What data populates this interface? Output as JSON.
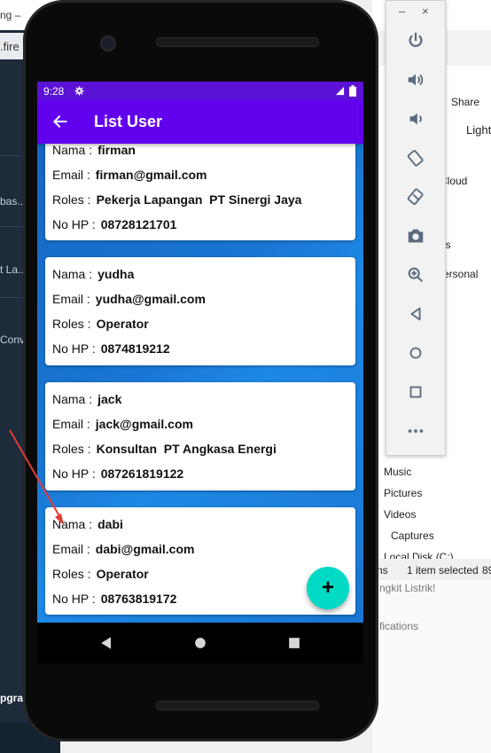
{
  "background": {
    "left_texts": [
      "ng –",
      ".fire",
      "bas..",
      "t La..",
      "Conv",
      "pgra"
    ],
    "right_texts": [
      "Share",
      "Light",
      "Cloud",
      "es",
      "ersonal",
      "Music",
      "Pictures",
      "Videos",
      "Captures",
      "Local Disk (C:)",
      "ns",
      "1 item selected",
      "89",
      "ngkit Listrik!",
      "fications"
    ]
  },
  "toolbar": {
    "minimize": "–",
    "close": "×",
    "icons": [
      "power-icon",
      "volume-up-icon",
      "volume-down-icon",
      "rotate-left-icon",
      "rotate-right-icon",
      "camera-icon",
      "zoom-icon",
      "back-icon",
      "home-icon",
      "overview-icon",
      "more-icon"
    ]
  },
  "status_bar": {
    "time": "9:28"
  },
  "app_bar": {
    "title": "List User"
  },
  "users": [
    {
      "nama_label": "Nama :",
      "nama": "firman",
      "email_label": "Email :",
      "email": "firman@gmail.com",
      "roles_label": "Roles :",
      "roles": "Pekerja Lapangan  PT Sinergi Jaya",
      "hp_label": "No HP :",
      "hp": "08728121701"
    },
    {
      "nama_label": "Nama :",
      "nama": "yudha",
      "email_label": "Email :",
      "email": "yudha@gmail.com",
      "roles_label": "Roles :",
      "roles": "Operator",
      "hp_label": "No HP :",
      "hp": "0874819212"
    },
    {
      "nama_label": "Nama :",
      "nama": "jack",
      "email_label": "Email :",
      "email": "jack@gmail.com",
      "roles_label": "Roles :",
      "roles": "Konsultan  PT Angkasa Energi",
      "hp_label": "No HP :",
      "hp": "087261819122"
    },
    {
      "nama_label": "Nama :",
      "nama": "dabi",
      "email_label": "Email :",
      "email": "dabi@gmail.com",
      "roles_label": "Roles :",
      "roles": "Operator",
      "hp_label": "No HP :",
      "hp": "08763819172"
    }
  ],
  "fab": {
    "label": "+"
  },
  "colors": {
    "primary": "#6200ee",
    "status_bar": "#5b12d6",
    "fab": "#03dac5",
    "annotation_arrow": "#e53935"
  }
}
